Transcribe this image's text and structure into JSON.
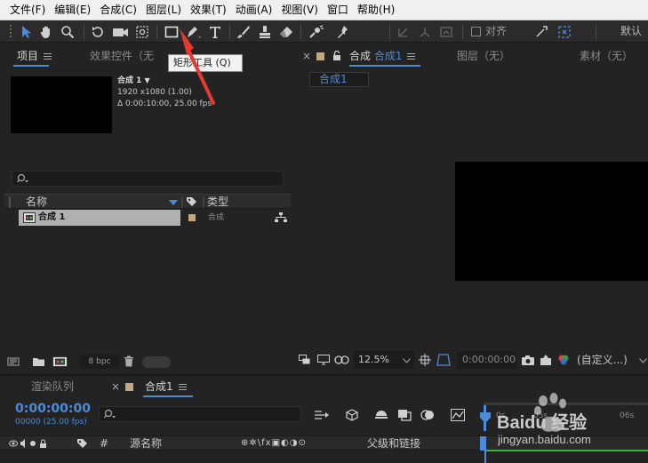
{
  "menubar": {
    "items": [
      "文件(F)",
      "编辑(E)",
      "合成(C)",
      "图层(L)",
      "效果(T)",
      "动画(A)",
      "视图(V)",
      "窗口",
      "帮助(H)"
    ]
  },
  "toolbar": {
    "tools": [
      "selection-tool",
      "hand-tool",
      "zoom-tool",
      "rotation-tool",
      "camera-tool",
      "pan-behind-tool",
      "rectangle-tool",
      "pen-tool",
      "type-tool",
      "brush-tool",
      "clone-stamp-tool",
      "eraser-tool",
      "roto-brush-tool",
      "puppet-pin-tool"
    ],
    "snap_label": "对齐",
    "workspace_label": "默认"
  },
  "tooltip": {
    "text": "矩形工具 (Q)"
  },
  "project_panel": {
    "tab_project": "项目",
    "tab_effects": "效果控件（无",
    "comp_name": "合成 1",
    "comp_resolution": "1920 x1080 (1.00)",
    "comp_duration": "Δ 0:00:10:00, 25.00 fps",
    "col_name": "名称",
    "col_type": "类型",
    "item_name": "合成 1",
    "item_type": "合成",
    "bpc_label": "8 bpc"
  },
  "comp_panel": {
    "tab_label": "合成",
    "tab_comp_name": "合成1",
    "tab_layer": "图层（无）",
    "tab_footage": "素材（无）",
    "sub_tab": "合成1",
    "zoom": "12.5%",
    "timecode": "0:00:00:00",
    "view_label": "(自定义...)"
  },
  "timeline": {
    "tab_render_queue": "渲染队列",
    "tab_comp": "合成1",
    "current_time": "0:00:00:00",
    "current_frame": "00000 (25.00 fps)",
    "col_number": "#",
    "col_source_name": "源名称",
    "col_parent": "父级和链接",
    "ruler_marks": [
      "0s",
      "05s",
      "06s"
    ]
  },
  "watermark": {
    "logo_text": "Baidu 经验",
    "url": "jingyan.baidu.com"
  },
  "colors": {
    "accent": "#4d8bd8",
    "menu_bg": "#f0f0f0",
    "panel_bg": "#232323",
    "label_tan": "#c2a87e",
    "arrow_red": "#e8392f",
    "timeline_green": "#2fb83a"
  }
}
